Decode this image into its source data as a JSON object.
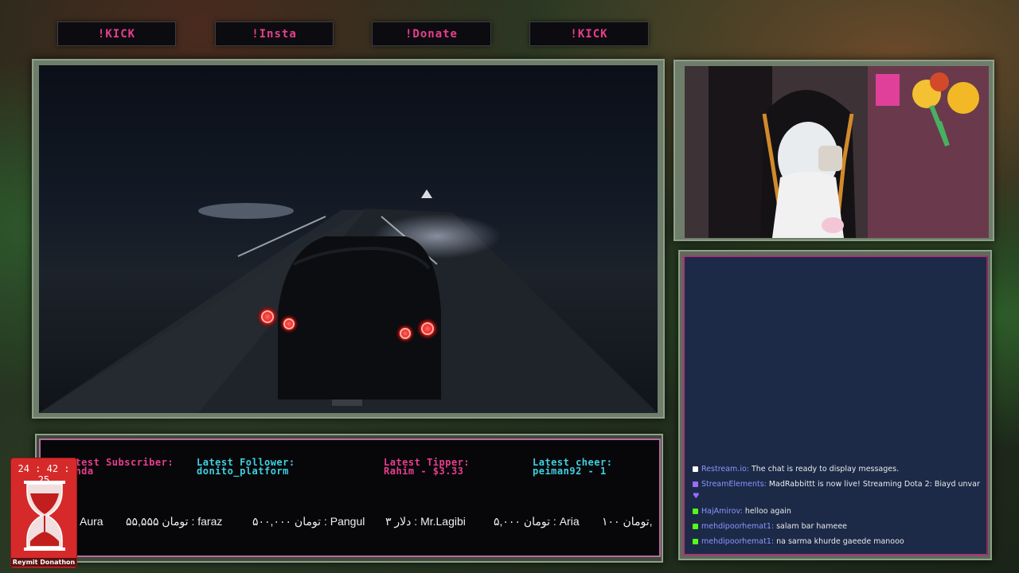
{
  "top_buttons": [
    {
      "label": "!KICK"
    },
    {
      "label": "!Insta"
    },
    {
      "label": "!Donate"
    },
    {
      "label": "!KICK"
    }
  ],
  "ticker": {
    "stats": [
      {
        "label": "Latest Subscriber:",
        "value": "Wanda",
        "label_color": "#e83e8c"
      },
      {
        "label": "Latest Follower:",
        "value": "donito_platform",
        "label_color": "#3fd0e0"
      },
      {
        "label": "Latest Tipper:",
        "value": "Rahim - $3.33",
        "label_color": "#e83e8c"
      },
      {
        "label": "Latest cheer:",
        "value": "peiman92 - 1",
        "label_color": "#3fd0e0"
      }
    ],
    "donors": [
      "Aura",
      "۵۵,۵۵۵ تومان : faraz",
      "۵۰۰,۰۰۰ تومان : Pangul",
      "۳ دلار : Mr.Lagibi",
      "۵,۰۰۰ تومان : Aria",
      "۱۰۰ تومان,"
    ]
  },
  "timer": {
    "time": "24 : 42 : 25",
    "label": "Reymit Donathon"
  },
  "chat": {
    "messages": [
      {
        "badge": "restream",
        "user": "Restream.io:",
        "text": "The chat is ready to display messages."
      },
      {
        "badge": "streamelements",
        "user": "StreamElements:",
        "text": "MadRabbittt is now live! Streaming Dota 2: Biayd unvar",
        "extra": "♥"
      },
      {
        "badge": "kick",
        "user": "HajAmirov:",
        "text": "helloo again"
      },
      {
        "badge": "kick",
        "user": "mehdipoorhemat1:",
        "text": "salam bar hameee"
      },
      {
        "badge": "kick",
        "user": "mehdipoorhemat1:",
        "text": "na sarma khurde gaeede manooo"
      }
    ]
  },
  "colors": {
    "accent_pink": "#e83e8c",
    "accent_cyan": "#3fd0e0",
    "chat_bg": "#1c2a48",
    "timer_red": "#d62a2a"
  }
}
